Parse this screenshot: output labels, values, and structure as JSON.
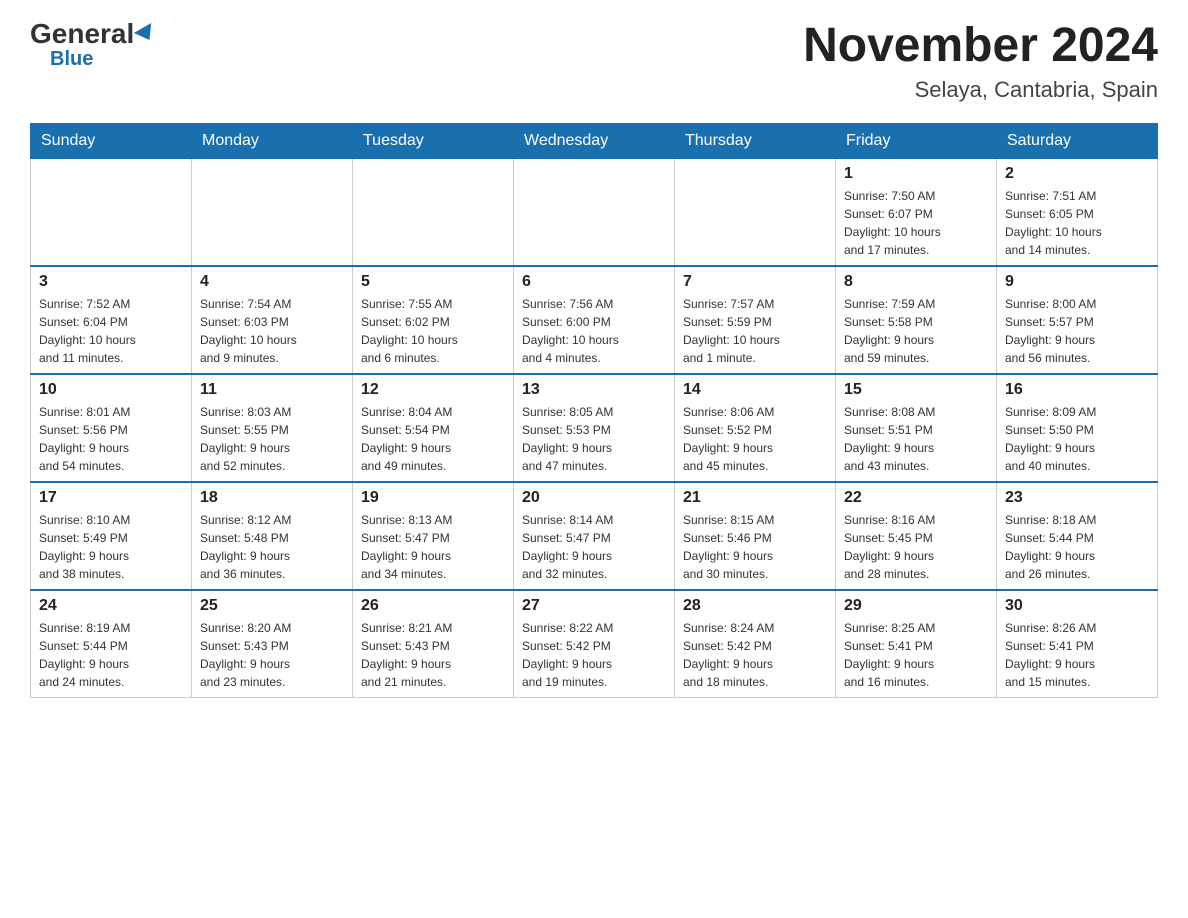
{
  "header": {
    "logo_general": "General",
    "logo_blue": "Blue",
    "month_title": "November 2024",
    "location": "Selaya, Cantabria, Spain"
  },
  "days_of_week": [
    "Sunday",
    "Monday",
    "Tuesday",
    "Wednesday",
    "Thursday",
    "Friday",
    "Saturday"
  ],
  "weeks": [
    [
      {
        "day": "",
        "info": ""
      },
      {
        "day": "",
        "info": ""
      },
      {
        "day": "",
        "info": ""
      },
      {
        "day": "",
        "info": ""
      },
      {
        "day": "",
        "info": ""
      },
      {
        "day": "1",
        "info": "Sunrise: 7:50 AM\nSunset: 6:07 PM\nDaylight: 10 hours\nand 17 minutes."
      },
      {
        "day": "2",
        "info": "Sunrise: 7:51 AM\nSunset: 6:05 PM\nDaylight: 10 hours\nand 14 minutes."
      }
    ],
    [
      {
        "day": "3",
        "info": "Sunrise: 7:52 AM\nSunset: 6:04 PM\nDaylight: 10 hours\nand 11 minutes."
      },
      {
        "day": "4",
        "info": "Sunrise: 7:54 AM\nSunset: 6:03 PM\nDaylight: 10 hours\nand 9 minutes."
      },
      {
        "day": "5",
        "info": "Sunrise: 7:55 AM\nSunset: 6:02 PM\nDaylight: 10 hours\nand 6 minutes."
      },
      {
        "day": "6",
        "info": "Sunrise: 7:56 AM\nSunset: 6:00 PM\nDaylight: 10 hours\nand 4 minutes."
      },
      {
        "day": "7",
        "info": "Sunrise: 7:57 AM\nSunset: 5:59 PM\nDaylight: 10 hours\nand 1 minute."
      },
      {
        "day": "8",
        "info": "Sunrise: 7:59 AM\nSunset: 5:58 PM\nDaylight: 9 hours\nand 59 minutes."
      },
      {
        "day": "9",
        "info": "Sunrise: 8:00 AM\nSunset: 5:57 PM\nDaylight: 9 hours\nand 56 minutes."
      }
    ],
    [
      {
        "day": "10",
        "info": "Sunrise: 8:01 AM\nSunset: 5:56 PM\nDaylight: 9 hours\nand 54 minutes."
      },
      {
        "day": "11",
        "info": "Sunrise: 8:03 AM\nSunset: 5:55 PM\nDaylight: 9 hours\nand 52 minutes."
      },
      {
        "day": "12",
        "info": "Sunrise: 8:04 AM\nSunset: 5:54 PM\nDaylight: 9 hours\nand 49 minutes."
      },
      {
        "day": "13",
        "info": "Sunrise: 8:05 AM\nSunset: 5:53 PM\nDaylight: 9 hours\nand 47 minutes."
      },
      {
        "day": "14",
        "info": "Sunrise: 8:06 AM\nSunset: 5:52 PM\nDaylight: 9 hours\nand 45 minutes."
      },
      {
        "day": "15",
        "info": "Sunrise: 8:08 AM\nSunset: 5:51 PM\nDaylight: 9 hours\nand 43 minutes."
      },
      {
        "day": "16",
        "info": "Sunrise: 8:09 AM\nSunset: 5:50 PM\nDaylight: 9 hours\nand 40 minutes."
      }
    ],
    [
      {
        "day": "17",
        "info": "Sunrise: 8:10 AM\nSunset: 5:49 PM\nDaylight: 9 hours\nand 38 minutes."
      },
      {
        "day": "18",
        "info": "Sunrise: 8:12 AM\nSunset: 5:48 PM\nDaylight: 9 hours\nand 36 minutes."
      },
      {
        "day": "19",
        "info": "Sunrise: 8:13 AM\nSunset: 5:47 PM\nDaylight: 9 hours\nand 34 minutes."
      },
      {
        "day": "20",
        "info": "Sunrise: 8:14 AM\nSunset: 5:47 PM\nDaylight: 9 hours\nand 32 minutes."
      },
      {
        "day": "21",
        "info": "Sunrise: 8:15 AM\nSunset: 5:46 PM\nDaylight: 9 hours\nand 30 minutes."
      },
      {
        "day": "22",
        "info": "Sunrise: 8:16 AM\nSunset: 5:45 PM\nDaylight: 9 hours\nand 28 minutes."
      },
      {
        "day": "23",
        "info": "Sunrise: 8:18 AM\nSunset: 5:44 PM\nDaylight: 9 hours\nand 26 minutes."
      }
    ],
    [
      {
        "day": "24",
        "info": "Sunrise: 8:19 AM\nSunset: 5:44 PM\nDaylight: 9 hours\nand 24 minutes."
      },
      {
        "day": "25",
        "info": "Sunrise: 8:20 AM\nSunset: 5:43 PM\nDaylight: 9 hours\nand 23 minutes."
      },
      {
        "day": "26",
        "info": "Sunrise: 8:21 AM\nSunset: 5:43 PM\nDaylight: 9 hours\nand 21 minutes."
      },
      {
        "day": "27",
        "info": "Sunrise: 8:22 AM\nSunset: 5:42 PM\nDaylight: 9 hours\nand 19 minutes."
      },
      {
        "day": "28",
        "info": "Sunrise: 8:24 AM\nSunset: 5:42 PM\nDaylight: 9 hours\nand 18 minutes."
      },
      {
        "day": "29",
        "info": "Sunrise: 8:25 AM\nSunset: 5:41 PM\nDaylight: 9 hours\nand 16 minutes."
      },
      {
        "day": "30",
        "info": "Sunrise: 8:26 AM\nSunset: 5:41 PM\nDaylight: 9 hours\nand 15 minutes."
      }
    ]
  ]
}
